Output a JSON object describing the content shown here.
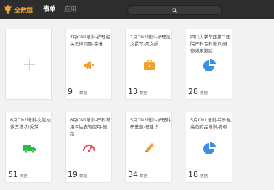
{
  "app": {
    "brand": "全数据"
  },
  "nav": {
    "form": "表单",
    "app": "应用"
  },
  "cards": [
    {
      "title": "7月CN1培训-护理相关法律问题-韦琳",
      "count": "9",
      "unit": "数据",
      "icon": "megaphone-icon",
      "color": "#f0a132"
    },
    {
      "title": "7月CN2培训-护理论文撰写-周文娟",
      "count": "13",
      "unit": "数据",
      "icon": "briefcase-icon",
      "color": "#f0a132"
    },
    {
      "title": "四川大学华西第二医院产科专科培训/进修效果追踪",
      "count": "28",
      "unit": "数据",
      "icon": "pie-chart-icon",
      "color": "#3d8ee4"
    },
    {
      "title": "6月CN2培训-文献检索方法-刘秀萍",
      "count": "51",
      "unit": "数据",
      "icon": "truck-icon",
      "color": "#2cbb4a"
    },
    {
      "title": "6月CN1培训-产科常用评估表的使用-鲍路",
      "count": "19",
      "unit": "数据",
      "icon": "gauge-icon",
      "color": "#e84b5b"
    },
    {
      "title": "5月CN2培训-护理科研选题-任建华",
      "count": "34",
      "unit": "数据",
      "icon": "pencil-icon",
      "color": "#f0a132"
    },
    {
      "title": "5月CN1培训-特殊及高危药品培训-孙敏",
      "count": "18",
      "unit": "数据",
      "icon": "pie-chart-icon",
      "color": "#3d8ee4"
    }
  ]
}
